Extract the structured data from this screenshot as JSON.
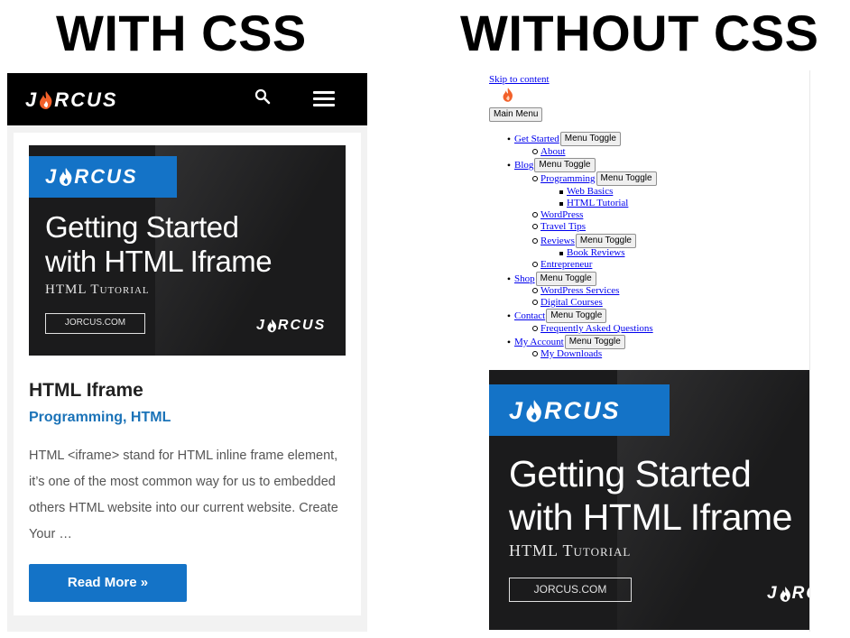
{
  "headings": {
    "with": "WITH CSS",
    "without": "WITHOUT CSS"
  },
  "brand": {
    "name": "JORCUS",
    "name_head": "J",
    "name_tail": "RCUS",
    "accent": "#1473c7",
    "flame": "#f2612a"
  },
  "banner": {
    "title_line1": "Getting Started",
    "title_line2": "with HTML Iframe",
    "subtitle": "HTML Tutorial",
    "url": "JORCUS.COM"
  },
  "styled": {
    "nav": {
      "search_icon": "search-icon",
      "menu_icon": "hamburger-icon"
    },
    "post": {
      "title": "HTML Iframe",
      "category1": "Programming",
      "separator": ",",
      "category2": "HTML",
      "excerpt": "HTML <iframe> stand for HTML inline frame element, it’s one of the most common way for us to embedded others HTML website into our current website. Create Your …",
      "read_more": "Read More »"
    }
  },
  "unstyled": {
    "skip": "Skip to content",
    "main_menu": "Main Menu",
    "toggle": "Menu Toggle",
    "menu": {
      "get_started": "Get Started",
      "about": "About",
      "blog": "Blog",
      "programming": "Programming",
      "web_basics": "Web Basics",
      "html_tutorial": "HTML Tutorial",
      "wordpress": "WordPress",
      "travel_tips": "Travel Tips",
      "reviews": "Reviews",
      "book_reviews": "Book Reviews",
      "entrepreneur": "Entrepreneur",
      "shop": "Shop",
      "wordpress_services": "WordPress Services",
      "digital_courses": "Digital Courses",
      "contact": "Contact",
      "faq": "Frequently Asked Questions",
      "my_account": "My Account",
      "my_downloads": "My Downloads"
    }
  }
}
